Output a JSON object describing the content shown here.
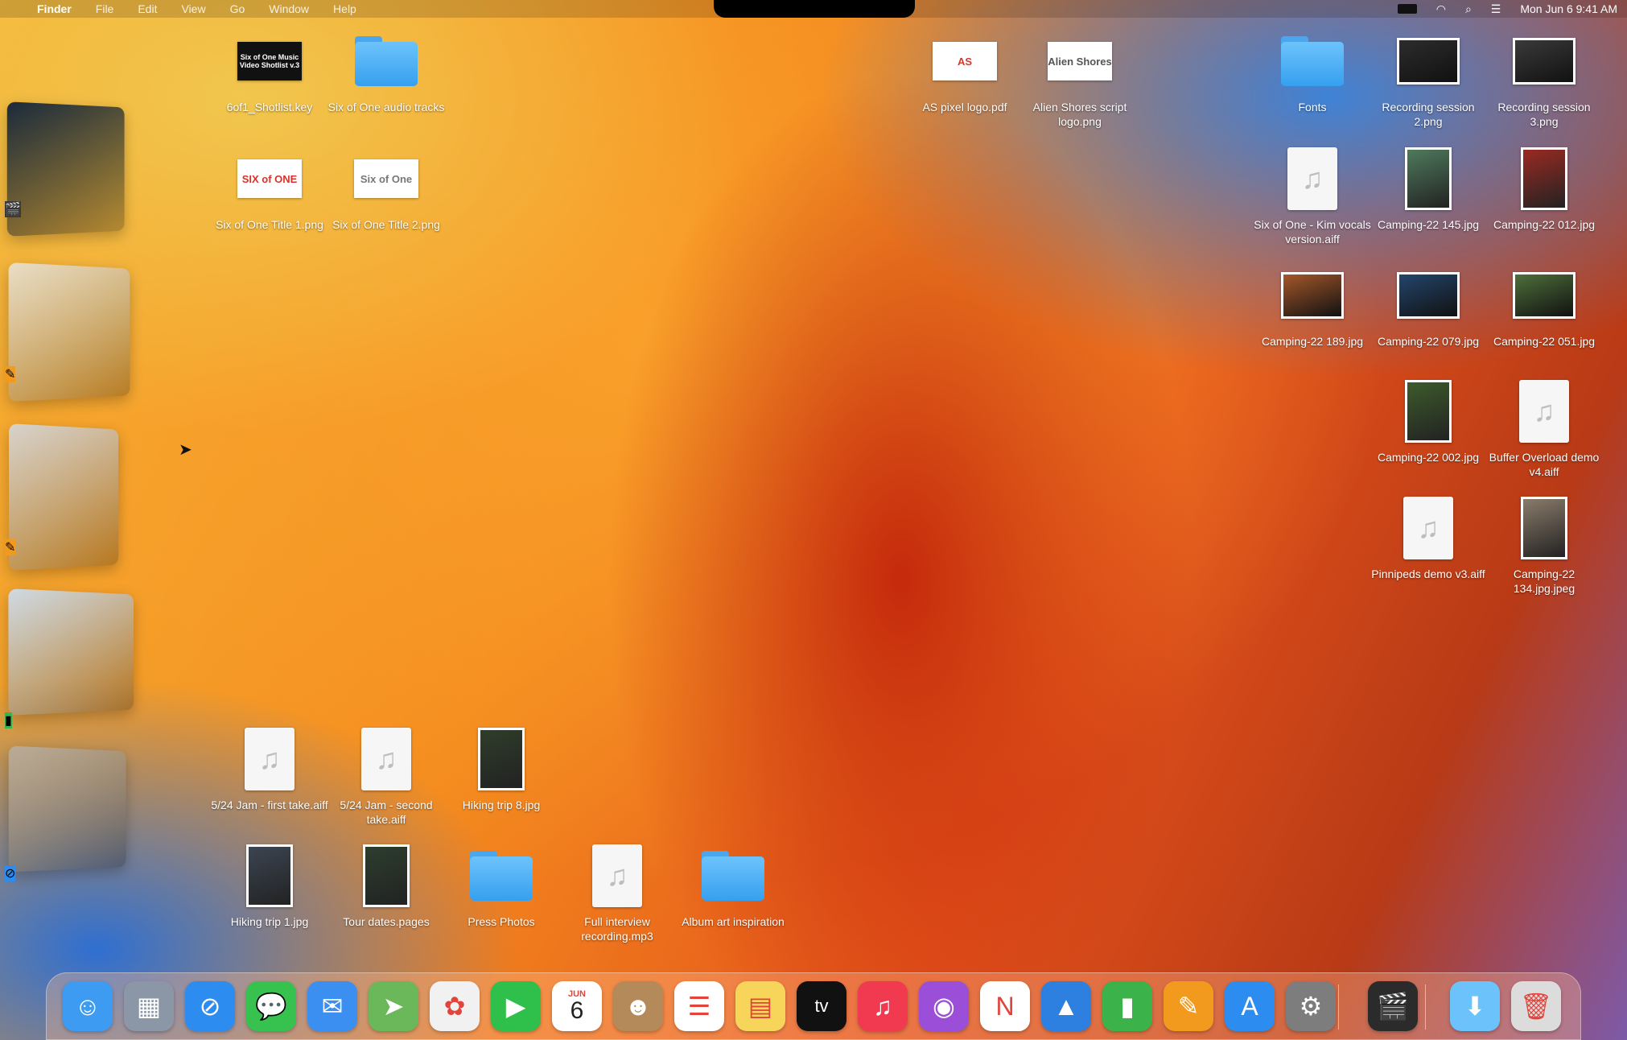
{
  "menubar": {
    "apple": "",
    "app_name": "Finder",
    "menus": [
      "File",
      "Edit",
      "View",
      "Go",
      "Window",
      "Help"
    ],
    "clock": "Mon Jun 6  9:41 AM"
  },
  "desktop_items": [
    {
      "label": "6of1_Shotlist.key",
      "kind": "card",
      "thumb_text": "Six of One Music Video Shotlist v.3",
      "color": "#111111"
    },
    {
      "label": "Six of One audio tracks",
      "kind": "folder"
    },
    {
      "label": "AS pixel logo.pdf",
      "kind": "card",
      "thumb_text": "AS",
      "color": "#d23a2a"
    },
    {
      "label": "Alien Shores script logo.png",
      "kind": "card",
      "thumb_text": "Alien Shores",
      "color": "#555555"
    },
    {
      "label": "Fonts",
      "kind": "folder"
    },
    {
      "label": "Recording session 2.png",
      "kind": "photo",
      "color": "#2c2c2c"
    },
    {
      "label": "Recording session 3.png",
      "kind": "photo",
      "color": "#3a3a3a"
    },
    {
      "label": "Six of One Title 1.png",
      "kind": "card",
      "thumb_text": "SIX of ONE",
      "color": "#d8322a"
    },
    {
      "label": "Six of One Title 2.png",
      "kind": "card",
      "thumb_text": "Six of One",
      "color": "#777777"
    },
    {
      "label": "Six of One - Kim vocals version.aiff",
      "kind": "audio"
    },
    {
      "label": "Camping-22 145.jpg",
      "kind": "photo-p",
      "color": "#4f7a5c"
    },
    {
      "label": "Camping-22 012.jpg",
      "kind": "photo-p",
      "color": "#9a2a22"
    },
    {
      "label": "Camping-22 189.jpg",
      "kind": "photo",
      "color": "#a4572a"
    },
    {
      "label": "Camping-22 079.jpg",
      "kind": "photo",
      "color": "#23456c"
    },
    {
      "label": "Camping-22 051.jpg",
      "kind": "photo",
      "color": "#4e6f3a"
    },
    {
      "label": "Camping-22 002.jpg",
      "kind": "photo-p",
      "color": "#3d5b2c"
    },
    {
      "label": "Buffer Overload demo v4.aiff",
      "kind": "audio"
    },
    {
      "label": "Pinnipeds demo v3.aiff",
      "kind": "audio"
    },
    {
      "label": "Camping-22 134.jpg.jpeg",
      "kind": "photo-p",
      "color": "#8a7b6a"
    },
    {
      "label": "5/24 Jam - first take.aiff",
      "kind": "audio"
    },
    {
      "label": "5/24 Jam - second take.aiff",
      "kind": "audio"
    },
    {
      "label": "Hiking trip 8.jpg",
      "kind": "photo-p",
      "color": "#2f3d2a"
    },
    {
      "label": "Hiking trip 1.jpg",
      "kind": "photo-p",
      "color": "#3b4552"
    },
    {
      "label": "Tour dates.pages",
      "kind": "photo-p",
      "color": "#2c3e2e"
    },
    {
      "label": "Press Photos",
      "kind": "folder"
    },
    {
      "label": "Full interview recording.mp3",
      "kind": "audio"
    },
    {
      "label": "Album art inspiration",
      "kind": "folder"
    }
  ],
  "stage_manager": [
    {
      "name": "Final Cut Pro group",
      "window_color": "#1a2a3a",
      "badge_icon": "🎬",
      "badge_color": "#3a3a3a"
    },
    {
      "name": "Pages group",
      "window_color": "#e9ddc6",
      "badge_icon": "✎",
      "badge_color": "#f29a1e"
    },
    {
      "name": "Pages and Notes group",
      "window_color": "#d7d2cc",
      "badge_icon": "✎",
      "badge_color": "#f29a1e"
    },
    {
      "name": "Numbers group",
      "window_color": "#cfd9e3",
      "badge_icon": "▮",
      "badge_color": "#3cb34a"
    },
    {
      "name": "Safari group",
      "window_color": "#b9ab98",
      "badge_icon": "⊘",
      "badge_color": "#2d8cf0"
    }
  ],
  "dock": [
    {
      "name": "finder",
      "icon": "☺",
      "color": "#3d9bf2"
    },
    {
      "name": "launchpad",
      "icon": "▦",
      "color": "#8b96a6"
    },
    {
      "name": "safari",
      "icon": "⊘",
      "color": "#2d8cf0"
    },
    {
      "name": "messages",
      "icon": "💬",
      "color": "#37c24f"
    },
    {
      "name": "mail",
      "icon": "✉",
      "color": "#3a8ff0"
    },
    {
      "name": "maps",
      "icon": "➤",
      "color": "#6bb85a"
    },
    {
      "name": "photos",
      "icon": "✿",
      "color": "#f1f1f1"
    },
    {
      "name": "facetime",
      "icon": "▶",
      "color": "#2fbf4b"
    },
    {
      "name": "calendar",
      "icon": "6",
      "color": "#ffffff"
    },
    {
      "name": "contacts",
      "icon": "☻",
      "color": "#b58a5a"
    },
    {
      "name": "reminders",
      "icon": "☰",
      "color": "#ffffff"
    },
    {
      "name": "notes",
      "icon": "▤",
      "color": "#f7d55a"
    },
    {
      "name": "apple-tv",
      "icon": "tv",
      "color": "#111111"
    },
    {
      "name": "music",
      "icon": "♫",
      "color": "#f1394f"
    },
    {
      "name": "podcasts",
      "icon": "◉",
      "color": "#9b4fd8"
    },
    {
      "name": "news",
      "icon": "N",
      "color": "#ffffff"
    },
    {
      "name": "keynote",
      "icon": "▲",
      "color": "#2d7fe0"
    },
    {
      "name": "numbers",
      "icon": "▮",
      "color": "#3cb34a"
    },
    {
      "name": "pages",
      "icon": "✎",
      "color": "#f29a1e"
    },
    {
      "name": "app-store",
      "icon": "A",
      "color": "#2d8cf0"
    },
    {
      "name": "system-settings",
      "icon": "⚙",
      "color": "#7d7d7d"
    },
    {
      "name": "final-cut-pro",
      "icon": "🎬",
      "color": "#2b2b2b"
    },
    {
      "name": "downloads",
      "icon": "⬇",
      "color": "#6cc3fb"
    },
    {
      "name": "trash",
      "icon": "🗑",
      "color": "#dcdcdc"
    }
  ],
  "calendar_month": "JUN"
}
